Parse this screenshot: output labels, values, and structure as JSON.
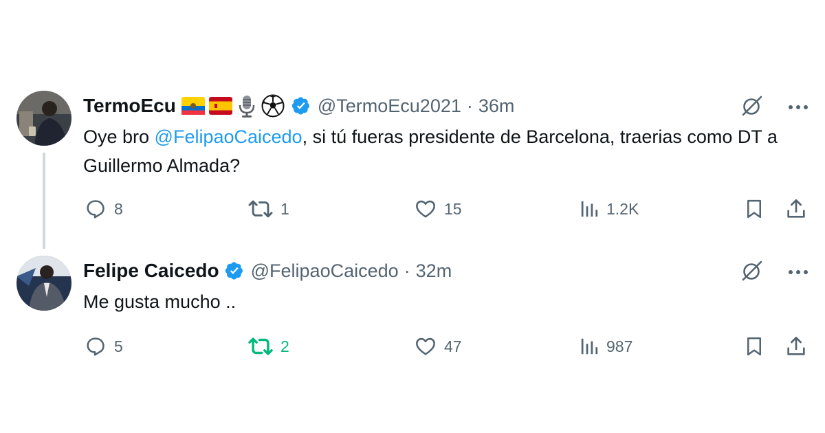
{
  "tweets": [
    {
      "name": "TermoEcu",
      "name_emojis": [
        "ecuador-flag-icon",
        "spain-flag-icon",
        "microphone-icon",
        "soccer-ball-icon"
      ],
      "verified": true,
      "handle": "@TermoEcu2021",
      "dot": "·",
      "time": "36m",
      "text_before": "Oye bro ",
      "mention": "@FelipaoCaicedo",
      "text_after": ", si tú fueras presidente de Barcelona, traerias como DT a Guillermo Almada?",
      "replies": "8",
      "reposts": "1",
      "likes": "15",
      "views": "1.2K",
      "reposted_by_user": false
    },
    {
      "name": "Felipe Caicedo",
      "verified": true,
      "handle": "@FelipaoCaicedo",
      "dot": "·",
      "time": "32m",
      "text": "Me gusta mucho ..",
      "replies": "5",
      "reposts": "2",
      "likes": "47",
      "views": "987",
      "reposted_by_user": true
    }
  ],
  "colors": {
    "text": "#0f1419",
    "secondary": "#536471",
    "mention": "#1d9bf0",
    "verified": "#1d9bf0",
    "repost_active": "#00ba7c",
    "thread_line": "#cfd9de"
  }
}
